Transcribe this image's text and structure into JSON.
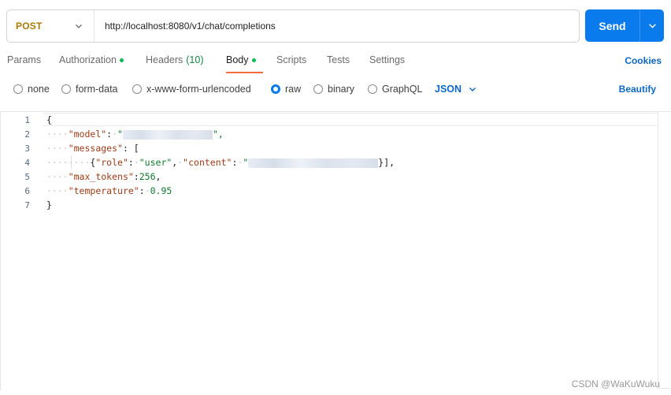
{
  "request": {
    "method": "POST",
    "url": "http://localhost:8080/v1/chat/completions",
    "send_label": "Send"
  },
  "tabs": [
    {
      "label": "Params",
      "active": false
    },
    {
      "label": "Authorization",
      "active": false,
      "dot": true
    },
    {
      "label": "Headers",
      "count": "(10)",
      "active": false
    },
    {
      "label": "Body",
      "active": true,
      "dot": true
    },
    {
      "label": "Scripts",
      "active": false
    },
    {
      "label": "Tests",
      "active": false
    },
    {
      "label": "Settings",
      "active": false
    }
  ],
  "cookies_label": "Cookies",
  "body_types": {
    "options": [
      "none",
      "form-data",
      "x-www-form-urlencoded",
      "raw",
      "binary",
      "GraphQL"
    ],
    "selected": "raw",
    "format": "JSON",
    "beautify_label": "Beautify"
  },
  "editor": {
    "line_numbers": [
      "1",
      "2",
      "3",
      "4",
      "5",
      "6",
      "7"
    ],
    "lines": {
      "l1_brace_open": "{",
      "l2_key": "\"model\"",
      "l2_colon": ":",
      "l2_open_quote": "\"",
      "l2_close": "\",",
      "l3_key": "\"messages\"",
      "l3_rest": ": [",
      "l4_open": "{",
      "l4_role_key": "\"role\"",
      "l4_colon1": ":",
      "l4_role_val": "\"user\"",
      "l4_comma": ",",
      "l4_content_key": "\"content\"",
      "l4_colon2": ":",
      "l4_open_quote": "\"",
      "l4_close": "}],",
      "l5_key": "\"max_tokens\"",
      "l5_colon": ":",
      "l5_val": "256",
      "l5_comma": ",",
      "l6_key": "\"temperature\"",
      "l6_colon": ":",
      "l6_val": "0.95",
      "l7_brace_close": "}"
    }
  },
  "watermark": "CSDN @WaKuWuku",
  "colors": {
    "method": "#ad7a03",
    "send": "#097bed",
    "accent_link": "#0b67c4",
    "active_tab_underline": "#f26b3a",
    "dot": "#0cbb52",
    "json_key": "#a03b17",
    "json_value": "#0f7a2e"
  }
}
